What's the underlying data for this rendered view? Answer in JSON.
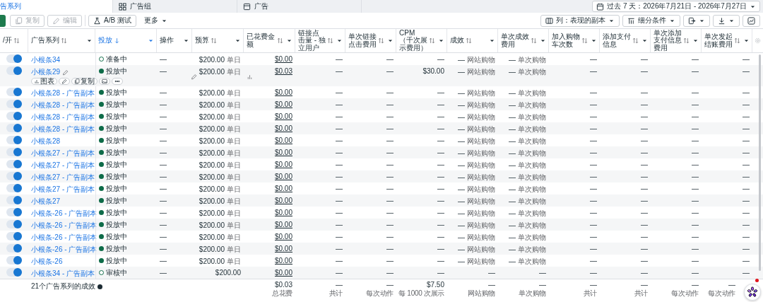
{
  "tabs": [
    {
      "label": "告系列",
      "selected": true
    },
    {
      "label": "广告组",
      "selected": false
    },
    {
      "label": "广告",
      "selected": false
    }
  ],
  "date_range": {
    "label": "过去 7 天：2026年7月21日 - 2026年7月27日"
  },
  "toolbar_left": [
    {
      "label": "复制",
      "disabled": true,
      "menu": false
    },
    {
      "label": "编辑",
      "disabled": true,
      "menu": false
    },
    {
      "label": "A/B 测试",
      "disabled": false,
      "menu": false
    },
    {
      "label": "更多",
      "disabled": false,
      "menu": true
    }
  ],
  "toolbar_right": [
    {
      "label": "列：表现的副本",
      "menu": true
    },
    {
      "label": "细分条件",
      "menu": true
    },
    {
      "menu": true
    },
    {
      "menu": true
    },
    {
      "menu": false
    }
  ],
  "columns": [
    {
      "label": "/开",
      "sortable": true,
      "sorted": false,
      "menu": false
    },
    {
      "label": "广告系列",
      "sortable": true,
      "sorted": false,
      "menu": true
    },
    {
      "label": "投放",
      "sortable": true,
      "sorted": true,
      "menu": true
    },
    {
      "label": "操作",
      "sortable": false,
      "sorted": false,
      "menu": true
    },
    {
      "label": "预算",
      "sortable": true,
      "sorted": false,
      "menu": true
    },
    {
      "label": "已花费金额",
      "sortable": true,
      "sorted": false,
      "menu": true
    },
    {
      "label": "链接点击量 - 独立用户",
      "sortable": true,
      "sorted": false,
      "menu": true
    },
    {
      "label": "单次链接点击费用",
      "sortable": true,
      "sorted": false,
      "menu": true
    },
    {
      "label": "CPM（千次展示费用）",
      "sortable": true,
      "sorted": false,
      "menu": true
    },
    {
      "label": "成效",
      "sortable": true,
      "sorted": false,
      "menu": true
    },
    {
      "label": "单次成效费用",
      "sortable": true,
      "sorted": false,
      "menu": true
    },
    {
      "label": "加入购物车次数",
      "sortable": true,
      "sorted": false,
      "menu": true
    },
    {
      "label": "添加支付信息",
      "sortable": true,
      "sorted": false,
      "menu": true
    },
    {
      "label": "单次添加支付信息费用",
      "sortable": true,
      "sorted": false,
      "menu": true
    },
    {
      "label": "单次发起结账费用",
      "sortable": true,
      "sorted": false,
      "menu": true
    }
  ],
  "rows": [
    {
      "name": "小根条34",
      "on": true,
      "hovered": false,
      "status": "准备中",
      "kind": "pending",
      "action": "—",
      "budget": "$200.00",
      "budget_sub": "单日",
      "spent": "$0.00",
      "metrics": [
        {
          "value": "—"
        },
        {
          "value": "—"
        },
        {
          "value": "—"
        },
        {
          "value": "—",
          "sub": "网站购物"
        },
        {
          "value": "—",
          "sub": "单次购物"
        },
        {
          "value": "—"
        },
        {
          "value": "—"
        },
        {
          "value": "—"
        },
        {
          "value": "—"
        }
      ]
    },
    {
      "name": "小根条29",
      "on": true,
      "hovered": true,
      "actions": [
        {
          "kind": "chart",
          "label": "图表"
        },
        {
          "kind": "edit"
        },
        {
          "kind": "copy",
          "label": "复制"
        },
        {
          "kind": "image"
        },
        {
          "kind": "more"
        }
      ],
      "status": "投放中",
      "kind": "active",
      "action": "—",
      "budget": "$200.00",
      "budget_sub": "单日",
      "spent": "$0.03",
      "metrics": [
        {
          "value": "—"
        },
        {
          "value": "—"
        },
        {
          "value": "$30.00"
        },
        {
          "value": "—",
          "sub": "网站购物"
        },
        {
          "value": "—",
          "sub": "单次购物"
        },
        {
          "value": "—"
        },
        {
          "value": "—"
        },
        {
          "value": "—"
        },
        {
          "value": "—"
        }
      ]
    },
    {
      "name": "小根条28 - 广告副本",
      "on": true,
      "hovered": false,
      "status": "投放中",
      "kind": "active",
      "action": "—",
      "budget": "$200.00",
      "budget_sub": "单日",
      "spent": "$0.00",
      "metrics": [
        {
          "value": "—"
        },
        {
          "value": "—"
        },
        {
          "value": "—"
        },
        {
          "value": "—",
          "sub": "网站购物"
        },
        {
          "value": "—",
          "sub": "单次购物"
        },
        {
          "value": "—"
        },
        {
          "value": "—"
        },
        {
          "value": "—"
        },
        {
          "value": "—"
        }
      ]
    },
    {
      "name": "小根条28 - 广告副本",
      "on": true,
      "hovered": false,
      "status": "投放中",
      "kind": "active",
      "action": "—",
      "budget": "$200.00",
      "budget_sub": "单日",
      "spent": "$0.00",
      "metrics": [
        {
          "value": "—"
        },
        {
          "value": "—"
        },
        {
          "value": "—"
        },
        {
          "value": "—",
          "sub": "网站购物"
        },
        {
          "value": "—",
          "sub": "单次购物"
        },
        {
          "value": "—"
        },
        {
          "value": "—"
        },
        {
          "value": "—"
        },
        {
          "value": "—"
        }
      ]
    },
    {
      "name": "小根条28 - 广告副本",
      "on": true,
      "hovered": false,
      "status": "投放中",
      "kind": "active",
      "action": "—",
      "budget": "$200.00",
      "budget_sub": "单日",
      "spent": "$0.00",
      "metrics": [
        {
          "value": "—"
        },
        {
          "value": "—"
        },
        {
          "value": "—"
        },
        {
          "value": "—",
          "sub": "网站购物"
        },
        {
          "value": "—",
          "sub": "单次购物"
        },
        {
          "value": "—"
        },
        {
          "value": "—"
        },
        {
          "value": "—"
        },
        {
          "value": "—"
        }
      ]
    },
    {
      "name": "小根条28 - 广告副本",
      "on": true,
      "hovered": false,
      "status": "投放中",
      "kind": "active",
      "action": "—",
      "budget": "$200.00",
      "budget_sub": "单日",
      "spent": "$0.00",
      "metrics": [
        {
          "value": "—"
        },
        {
          "value": "—"
        },
        {
          "value": "—"
        },
        {
          "value": "—",
          "sub": "网站购物"
        },
        {
          "value": "—",
          "sub": "单次购物"
        },
        {
          "value": "—"
        },
        {
          "value": "—"
        },
        {
          "value": "—"
        },
        {
          "value": "—"
        }
      ]
    },
    {
      "name": "小根条28",
      "on": true,
      "hovered": false,
      "status": "投放中",
      "kind": "active",
      "action": "—",
      "budget": "$200.00",
      "budget_sub": "单日",
      "spent": "$0.00",
      "metrics": [
        {
          "value": "—"
        },
        {
          "value": "—"
        },
        {
          "value": "—"
        },
        {
          "value": "—",
          "sub": "网站购物"
        },
        {
          "value": "—",
          "sub": "单次购物"
        },
        {
          "value": "—"
        },
        {
          "value": "—"
        },
        {
          "value": "—"
        },
        {
          "value": "—"
        }
      ]
    },
    {
      "name": "小根条27 - 广告副本",
      "on": true,
      "hovered": false,
      "status": "投放中",
      "kind": "active",
      "action": "—",
      "budget": "$200.00",
      "budget_sub": "单日",
      "spent": "$0.00",
      "metrics": [
        {
          "value": "—"
        },
        {
          "value": "—"
        },
        {
          "value": "—"
        },
        {
          "value": "—",
          "sub": "网站购物"
        },
        {
          "value": "—",
          "sub": "单次购物"
        },
        {
          "value": "—"
        },
        {
          "value": "—"
        },
        {
          "value": "—"
        },
        {
          "value": "—"
        }
      ]
    },
    {
      "name": "小根条27 - 广告副本",
      "on": true,
      "hovered": false,
      "status": "投放中",
      "kind": "active",
      "action": "—",
      "budget": "$200.00",
      "budget_sub": "单日",
      "spent": "$0.00",
      "metrics": [
        {
          "value": "—"
        },
        {
          "value": "—"
        },
        {
          "value": "—"
        },
        {
          "value": "—",
          "sub": "网站购物"
        },
        {
          "value": "—",
          "sub": "单次购物"
        },
        {
          "value": "—"
        },
        {
          "value": "—"
        },
        {
          "value": "—"
        },
        {
          "value": "—"
        }
      ]
    },
    {
      "name": "小根条27 - 广告副本",
      "on": true,
      "hovered": false,
      "status": "投放中",
      "kind": "active",
      "action": "—",
      "budget": "$200.00",
      "budget_sub": "单日",
      "spent": "$0.00",
      "metrics": [
        {
          "value": "—"
        },
        {
          "value": "—"
        },
        {
          "value": "—"
        },
        {
          "value": "—",
          "sub": "网站购物"
        },
        {
          "value": "—",
          "sub": "单次购物"
        },
        {
          "value": "—"
        },
        {
          "value": "—"
        },
        {
          "value": "—"
        },
        {
          "value": "—"
        }
      ]
    },
    {
      "name": "小根条27 - 广告副本",
      "on": true,
      "hovered": false,
      "status": "投放中",
      "kind": "active",
      "action": "—",
      "budget": "$200.00",
      "budget_sub": "单日",
      "spent": "$0.00",
      "metrics": [
        {
          "value": "—"
        },
        {
          "value": "—"
        },
        {
          "value": "—"
        },
        {
          "value": "—",
          "sub": "网站购物"
        },
        {
          "value": "—",
          "sub": "单次购物"
        },
        {
          "value": "—"
        },
        {
          "value": "—"
        },
        {
          "value": "—"
        },
        {
          "value": "—"
        }
      ]
    },
    {
      "name": "小根条27",
      "on": true,
      "hovered": false,
      "status": "投放中",
      "kind": "active",
      "action": "—",
      "budget": "$200.00",
      "budget_sub": "单日",
      "spent": "$0.00",
      "metrics": [
        {
          "value": "—"
        },
        {
          "value": "—"
        },
        {
          "value": "—"
        },
        {
          "value": "—",
          "sub": "网站购物"
        },
        {
          "value": "—",
          "sub": "单次购物"
        },
        {
          "value": "—"
        },
        {
          "value": "—"
        },
        {
          "value": "—"
        },
        {
          "value": "—"
        }
      ]
    },
    {
      "name": "小根条-26 - 广告副本",
      "on": true,
      "hovered": false,
      "status": "投放中",
      "kind": "active",
      "action": "—",
      "budget": "$200.00",
      "budget_sub": "单日",
      "spent": "$0.00",
      "metrics": [
        {
          "value": "—"
        },
        {
          "value": "—"
        },
        {
          "value": "—"
        },
        {
          "value": "—",
          "sub": "网站购物"
        },
        {
          "value": "—",
          "sub": "单次购物"
        },
        {
          "value": "—"
        },
        {
          "value": "—"
        },
        {
          "value": "—"
        },
        {
          "value": "—"
        }
      ]
    },
    {
      "name": "小根条-26 - 广告副本",
      "on": true,
      "hovered": false,
      "status": "投放中",
      "kind": "active",
      "action": "—",
      "budget": "$200.00",
      "budget_sub": "单日",
      "spent": "$0.00",
      "metrics": [
        {
          "value": "—"
        },
        {
          "value": "—"
        },
        {
          "value": "—"
        },
        {
          "value": "—",
          "sub": "网站购物"
        },
        {
          "value": "—",
          "sub": "单次购物"
        },
        {
          "value": "—"
        },
        {
          "value": "—"
        },
        {
          "value": "—"
        },
        {
          "value": "—"
        }
      ]
    },
    {
      "name": "小根条-26 - 广告副本",
      "on": true,
      "hovered": false,
      "status": "投放中",
      "kind": "active",
      "action": "—",
      "budget": "$200.00",
      "budget_sub": "单日",
      "spent": "$0.00",
      "metrics": [
        {
          "value": "—"
        },
        {
          "value": "—"
        },
        {
          "value": "—"
        },
        {
          "value": "—",
          "sub": "网站购物"
        },
        {
          "value": "—",
          "sub": "单次购物"
        },
        {
          "value": "—"
        },
        {
          "value": "—"
        },
        {
          "value": "—"
        },
        {
          "value": "—"
        }
      ]
    },
    {
      "name": "小根条-26 - 广告副本",
      "on": true,
      "hovered": false,
      "status": "投放中",
      "kind": "active",
      "action": "—",
      "budget": "$200.00",
      "budget_sub": "单日",
      "spent": "$0.00",
      "metrics": [
        {
          "value": "—"
        },
        {
          "value": "—"
        },
        {
          "value": "—"
        },
        {
          "value": "—",
          "sub": "网站购物"
        },
        {
          "value": "—",
          "sub": "单次购物"
        },
        {
          "value": "—"
        },
        {
          "value": "—"
        },
        {
          "value": "—"
        },
        {
          "value": "—"
        }
      ]
    },
    {
      "name": "小根条-26",
      "on": true,
      "hovered": false,
      "status": "投放中",
      "kind": "active",
      "action": "—",
      "budget": "$200.00",
      "budget_sub": "单日",
      "spent": "$0.00",
      "metrics": [
        {
          "value": "—"
        },
        {
          "value": "—"
        },
        {
          "value": "—"
        },
        {
          "value": "—",
          "sub": "网站购物"
        },
        {
          "value": "—",
          "sub": "单次购物"
        },
        {
          "value": "—"
        },
        {
          "value": "—"
        },
        {
          "value": "—"
        },
        {
          "value": "—"
        }
      ]
    },
    {
      "name": "小根条34 - 广告副本",
      "on": true,
      "hovered": false,
      "status": "审核中",
      "kind": "pending",
      "action": "—",
      "budget": "$200.00",
      "spent": "$0.00",
      "metrics": [
        {
          "value": "—"
        },
        {
          "value": "—"
        },
        {
          "value": "—"
        },
        {
          "value": "—"
        },
        {
          "value": "—"
        },
        {
          "value": "—"
        },
        {
          "value": "—"
        },
        {
          "value": "—"
        },
        {
          "value": "—"
        }
      ]
    }
  ],
  "footer": {
    "label": "21个广告系列的成效",
    "cells": [
      {
        "value": "$0.03",
        "sub": "总花费"
      },
      {
        "value": "—",
        "sub": "共计"
      },
      {
        "value": "—",
        "sub": "每次动作"
      },
      {
        "value": "$7.50",
        "sub": "每 1000 次展示"
      },
      {
        "value": "—",
        "sub": "网站购物"
      },
      {
        "value": "—",
        "sub": "单次购物"
      },
      {
        "value": "—",
        "sub": "共计"
      },
      {
        "value": "—",
        "sub": "共计"
      },
      {
        "value": "—",
        "sub": "每次动作"
      },
      {
        "value": "—",
        "sub": "每次动作"
      }
    ]
  }
}
